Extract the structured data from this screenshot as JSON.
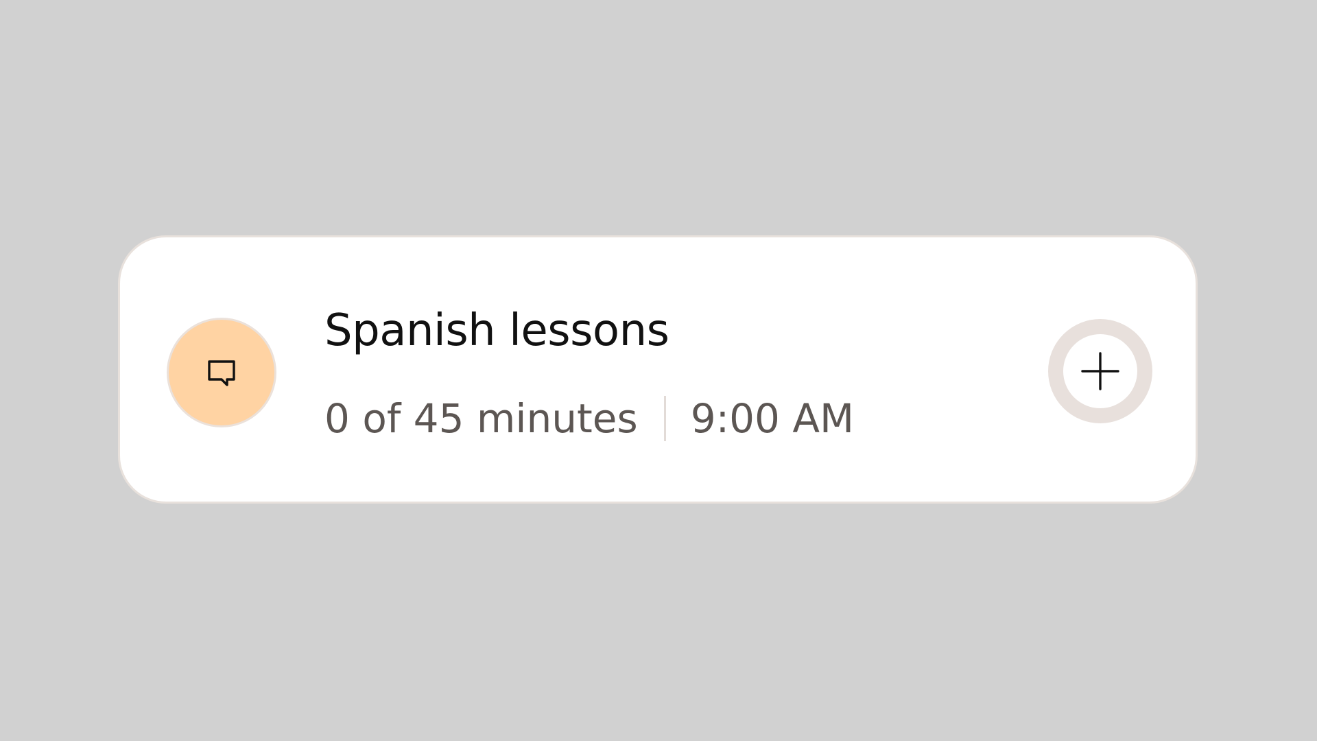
{
  "activity": {
    "title": "Spanish lessons",
    "progress_text": "0 of 45 minutes",
    "progress_minutes_done": 0,
    "progress_minutes_goal": 45,
    "time": "9:00 AM",
    "icon": "chat-bubble-icon"
  },
  "actions": {
    "add_icon": "plus-icon"
  },
  "colors": {
    "background": "#d1d1d1",
    "card": "#ffffff",
    "card_border": "#e8e1dc",
    "icon_accent": "#ffd3a3",
    "add_ring": "#e8e0dc",
    "title_text": "#111111",
    "meta_text": "#5c5653"
  }
}
